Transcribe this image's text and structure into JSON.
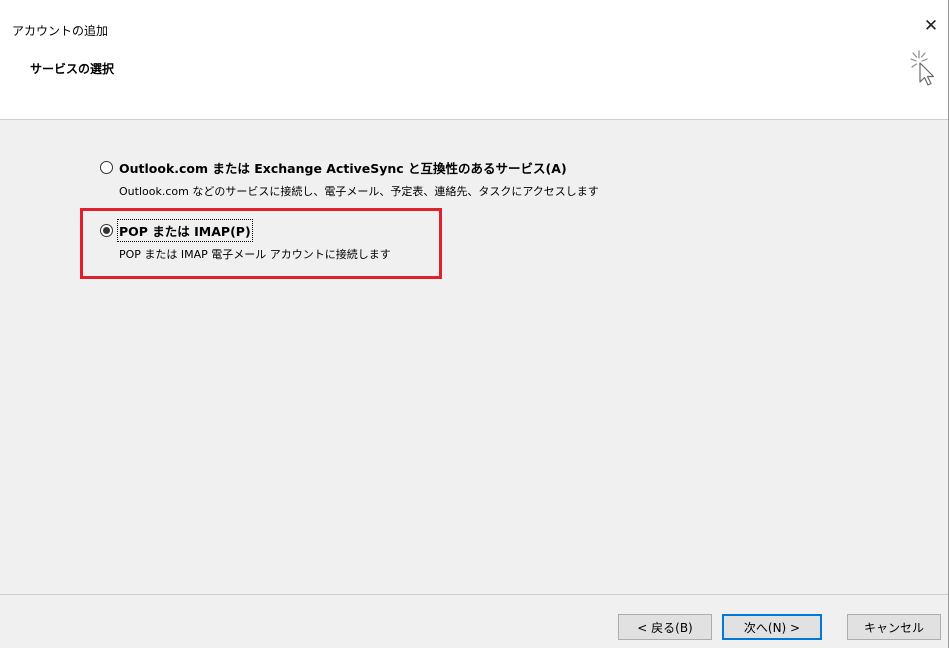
{
  "window": {
    "title": "アカウントの追加",
    "close_glyph": "✕"
  },
  "header": {
    "title": "サービスの選択",
    "icon": "sparkle-cursor-icon"
  },
  "options": [
    {
      "label": "Outlook.com または Exchange ActiveSync と互換性のあるサービス(A)",
      "description": "Outlook.com などのサービスに接続し、電子メール、予定表、連絡先、タスクにアクセスします",
      "selected": false
    },
    {
      "label": "POP または IMAP(P)",
      "description": "POP または IMAP 電子メール アカウントに接続します",
      "selected": true
    }
  ],
  "highlight_color": "#e0202a",
  "buttons": {
    "back": "< 戻る(B)",
    "next": "次へ(N) >",
    "cancel": "キャンセル"
  }
}
